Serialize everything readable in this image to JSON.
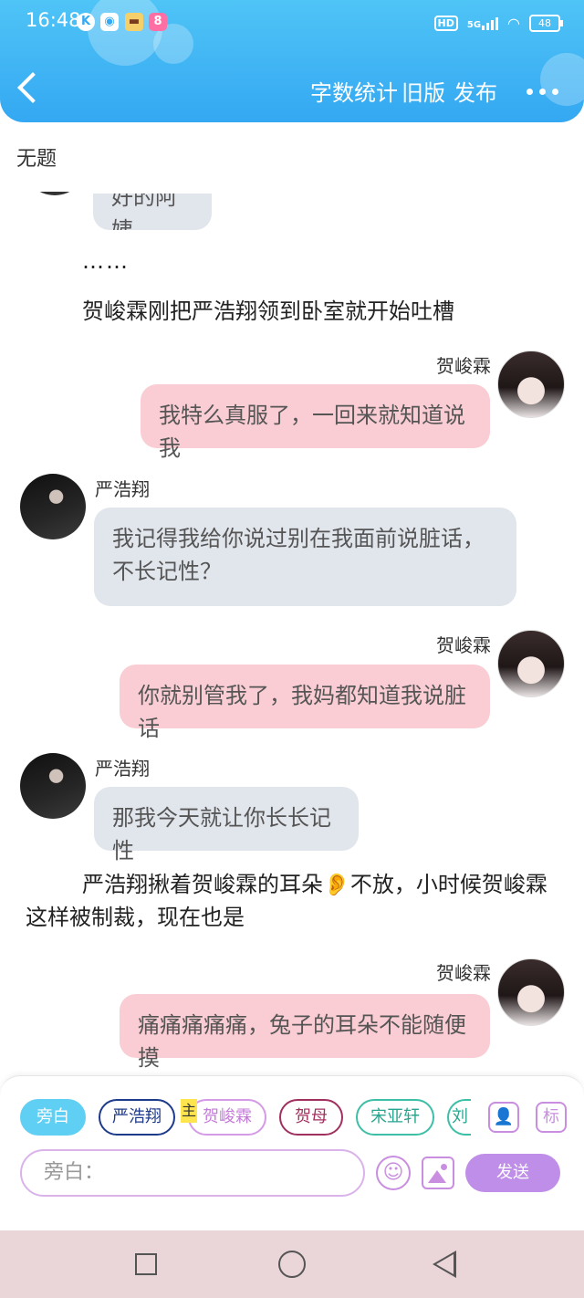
{
  "status_bar": {
    "time": "16:48",
    "left_icons": [
      "k-icon",
      "wifi-app-icon",
      "app-icon",
      "app2-icon"
    ],
    "network": "HD",
    "signal": "5G",
    "battery": "48"
  },
  "header": {
    "word_count_label": "字数统计",
    "old_version_label": "旧版",
    "publish_label": "发布"
  },
  "document": {
    "title": "无题"
  },
  "messages": [
    {
      "type": "left",
      "text": "好的阿姨"
    },
    {
      "type": "narration",
      "text": "……"
    },
    {
      "type": "narration",
      "text": "贺峻霖刚把严浩翔领到卧室就开始吐槽"
    },
    {
      "type": "right",
      "name": "贺峻霖",
      "text": "我特么真服了，一回来就知道说我"
    },
    {
      "type": "left",
      "name": "严浩翔",
      "text": "我记得我给你说过别在我面前说脏话，不长记性？"
    },
    {
      "type": "right",
      "name": "贺峻霖",
      "text": "你就别管我了，我妈都知道我说脏话"
    },
    {
      "type": "left",
      "name": "严浩翔",
      "text": "那我今天就让你长长记性"
    },
    {
      "type": "narration",
      "text": "严浩翔揪着贺峻霖的耳朵👂不放，小时候贺峻霖这样被制裁，现在也是"
    },
    {
      "type": "right",
      "name": "贺峻霖",
      "text": "痛痛痛痛痛，兔子的耳朵不能随便摸"
    }
  ],
  "roles": [
    "旁白",
    "严浩翔",
    "贺峻霖",
    "贺母",
    "宋亚轩",
    "刘"
  ],
  "role_badge": "主",
  "side_icons": {
    "role_icon": "👤",
    "tag_icon": "标"
  },
  "input": {
    "placeholder": "旁白："
  },
  "send_label": "发送",
  "colors": {
    "header": "#38aaf2",
    "right_bubble": "#f9cdd3",
    "left_bubble": "#e1e5ec",
    "send": "#bf8ee8"
  }
}
